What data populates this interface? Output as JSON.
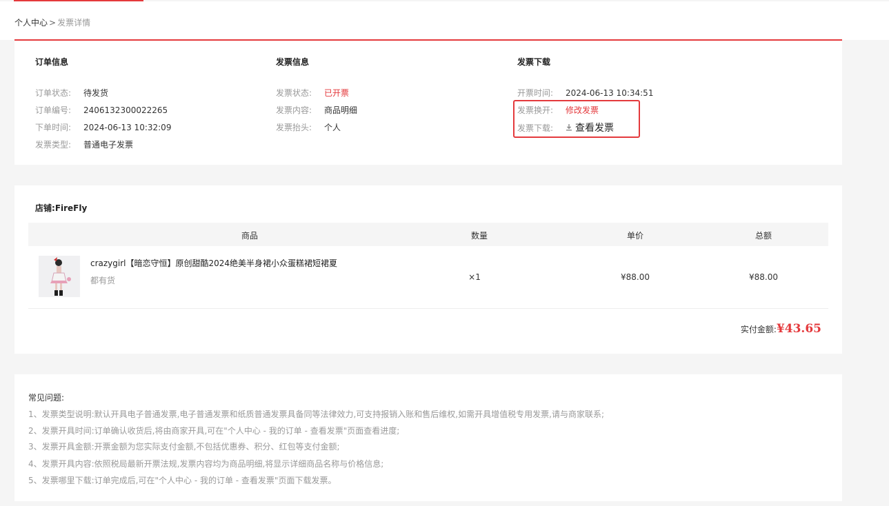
{
  "breadcrumb": {
    "home": "个人中心",
    "separator": ">",
    "current": "发票详情"
  },
  "order_info": {
    "title": "订单信息",
    "rows": [
      {
        "label": "订单状态:",
        "value": "待发货"
      },
      {
        "label": "订单编号:",
        "value": "2406132300022265"
      },
      {
        "label": "下单时间:",
        "value": "2024-06-13 10:32:09"
      },
      {
        "label": "发票类型:",
        "value": "普通电子发票"
      }
    ]
  },
  "invoice_info": {
    "title": "发票信息",
    "rows": [
      {
        "label": "发票状态:",
        "value": "已开票"
      },
      {
        "label": "发票内容:",
        "value": "商品明细"
      },
      {
        "label": "发票抬头:",
        "value": "个人"
      }
    ]
  },
  "invoice_download": {
    "title": "发票下载",
    "issue_time_label": "开票时间:",
    "issue_time_value": "2024-06-13 10:34:51",
    "reissue_label": "发票换开:",
    "reissue_link": "修改发票",
    "download_label": "发票下载:",
    "download_link": "查看发票",
    "download_icon": "download-icon"
  },
  "store": {
    "label": "店铺:",
    "name": "FireFly"
  },
  "table": {
    "headers": [
      "商品",
      "数量",
      "单价",
      "总额"
    ],
    "rows": [
      {
        "name": "crazygirl【暗恋守恒】原创甜酷2024绝美半身裙小众蛋糕裙短裙夏",
        "stock": "都有货",
        "quantity": "×1",
        "unit_price": "¥88.00",
        "total": "¥88.00"
      }
    ]
  },
  "payment": {
    "label": "实付金额:",
    "amount": "¥43.65"
  },
  "faq": {
    "title": "常见问题:",
    "items": [
      "1、发票类型说明:默认开具电子普通发票,电子普通发票和纸质普通发票具备同等法律效力,可支持报销入账和售后维权,如需开具增值税专用发票,请与商家联系;",
      "2、发票开具时间:订单确认收货后,将由商家开具,可在\"个人中心 - 我的订单 - 查看发票\"页面查看进度;",
      "3、发票开具金额:开票金额为您实际支付金额,不包括优惠券、积分、红包等支付金额;",
      "4、发票开具内容:依照税局最新开票法规,发票内容均为商品明细,将显示详细商品名称与价格信息;",
      "5、发票哪里下载:订单完成后,可在\"个人中心 - 我的订单 - 查看发票\"页面下载发票。"
    ]
  },
  "colors": {
    "accent": "#e4393c",
    "muted": "#999999"
  }
}
